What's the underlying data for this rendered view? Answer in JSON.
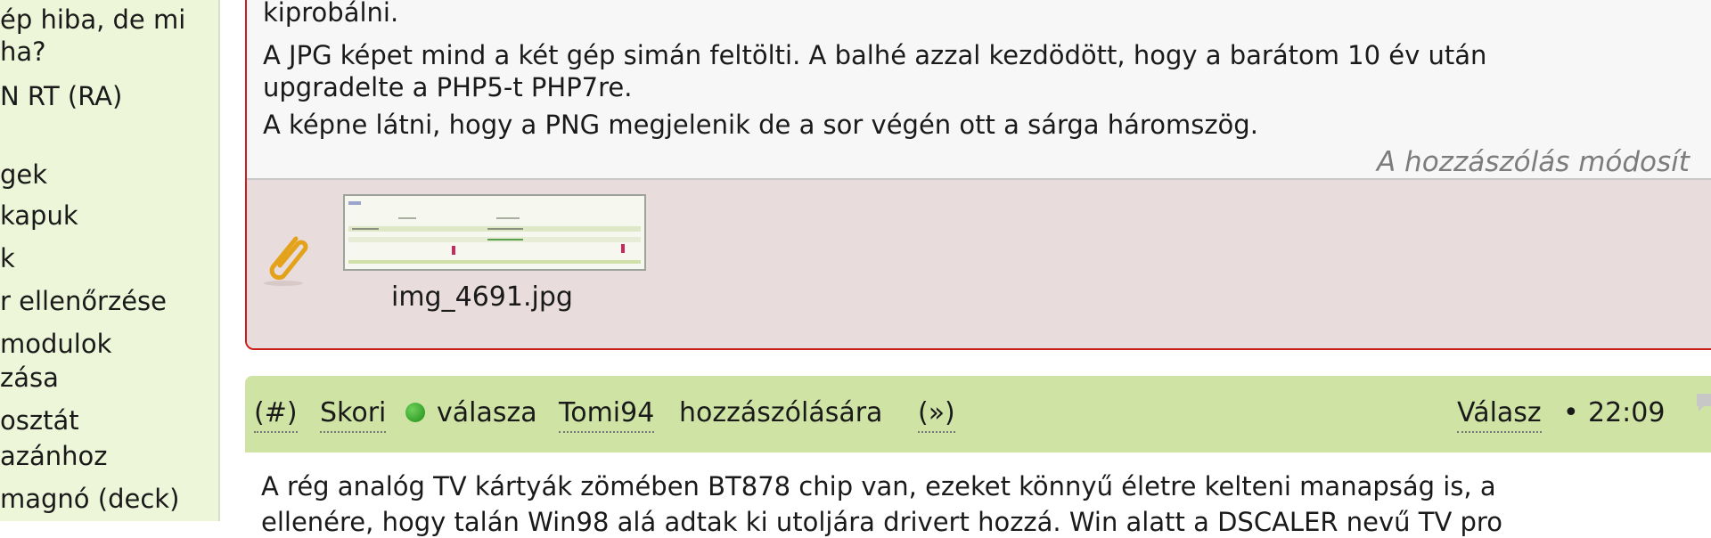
{
  "sidebar": {
    "items": [
      {
        "label": "ép hiba, de mi"
      },
      {
        "label": "ha?"
      },
      {
        "label": "N RT (RA)"
      },
      {
        "label": "gek"
      },
      {
        "label": "kapuk"
      },
      {
        "label": "k"
      },
      {
        "label": "r ellenőrzése"
      },
      {
        "label": "modulok"
      },
      {
        "label": "zása"
      },
      {
        "label": "osztát"
      },
      {
        "label": "azánhoz"
      },
      {
        "label": "magnó (deck)"
      }
    ]
  },
  "post1": {
    "lines": [
      "kiprobálni.",
      "A JPG képet mind a két gép simán feltölti. A balhé azzal kezdödött, hogy a barátom 10 év után",
      "upgradelte a PHP5-t PHP7re.",
      "A képne látni, hogy a PNG megjelenik de a sor végén ott a sárga háromszög."
    ],
    "edited_note": "A hozzászólás módosít",
    "attachment": {
      "icon": "paperclip-icon",
      "filename": "img_4691.jpg"
    }
  },
  "post2": {
    "header": {
      "anchor": "(#)",
      "author": "Skori",
      "reply_of": "válasza",
      "target_user": "Tomi94",
      "target_suffix": "hozzászólására",
      "jump": "(»)",
      "reply_button": "Válasz",
      "bullet": "•",
      "time": "22:09"
    },
    "lines": [
      "A rég analóg TV kártyák zömében BT878 chip van, ezeket könnyű életre kelteni manapság is, a",
      "ellenére, hogy talán Win98 alá adtak ki utoljára drivert hozzá. Win alatt a DSCALER nevű TV pro"
    ]
  },
  "colors": {
    "sidebar_bg": "#eef6d9",
    "quote_border": "#cc1d1d",
    "post_header_bg": "#cfe4a4",
    "attachment_bg": "#e8dcdc",
    "online_dot": "#2aa61f"
  }
}
